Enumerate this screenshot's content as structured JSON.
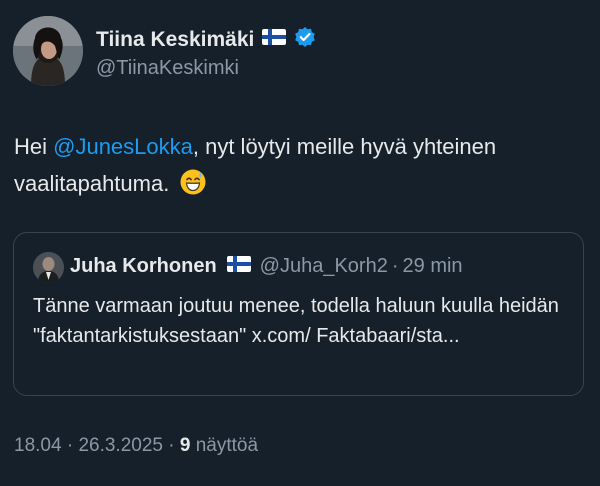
{
  "author": {
    "name": "Tiina Keskimäki",
    "handle": "@TiinaKeskimki",
    "flag_icon": "finland-flag-icon",
    "verified_icon": "verified-badge-icon",
    "verified_color": "#1d9bf0"
  },
  "tweet": {
    "text_before": "Hei ",
    "mention": "@JunesLokka",
    "text_after": ", nyt löytyi meille hyvä yhteinen vaalitapahtuma.",
    "emoji_icon": "grinning-sweat-emoji-icon"
  },
  "quoted": {
    "name": "Juha Korhonen",
    "flag_icon": "finland-flag-icon",
    "handle": "@Juha_Korh2",
    "separator": "·",
    "time": "29 min",
    "text": "Tänne varmaan joutuu menee, todella haluun kuulla heidän \"faktantarkistuksestaan\" x.com/ Faktabaari/sta..."
  },
  "footer": {
    "time": "18.04",
    "separator": " · ",
    "date": "26.3.2025",
    "separator2": " · ",
    "views_count": "9",
    "views_label": " näyttöä"
  },
  "colors": {
    "background": "#15202b",
    "text": "#e7e9ea",
    "muted": "#8b98a5",
    "link": "#1d9bf0",
    "border": "#38444d"
  }
}
